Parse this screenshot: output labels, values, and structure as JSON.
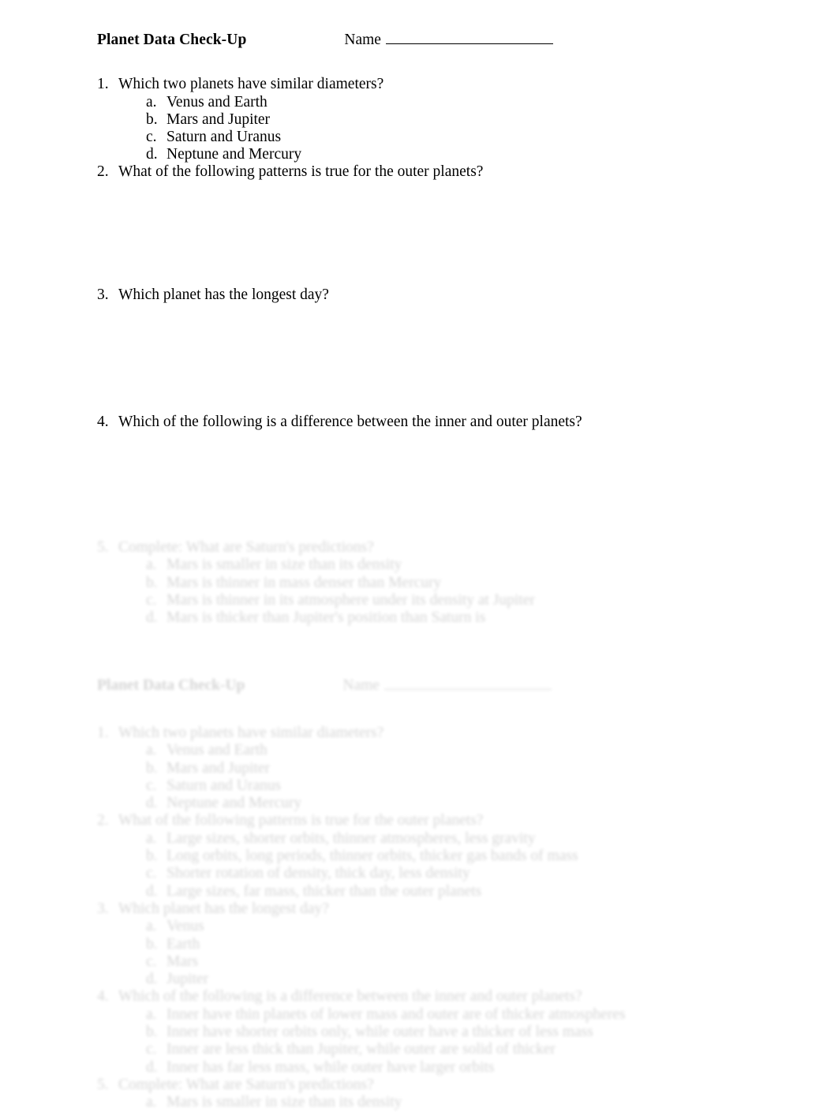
{
  "document": {
    "title": "Planet Data Check-Up",
    "name_label": "Name",
    "name_value": ""
  },
  "questions": [
    {
      "number": "1.",
      "text": "Which two planets have similar diameters?",
      "options": [
        {
          "letter": "a.",
          "text": "Venus and Earth"
        },
        {
          "letter": "b.",
          "text": "Mars and Jupiter"
        },
        {
          "letter": "c.",
          "text": "Saturn and Uranus"
        },
        {
          "letter": "d.",
          "text": "Neptune and Mercury"
        }
      ]
    },
    {
      "number": "2.",
      "text": "What of the following patterns is true for the outer planets?",
      "options": []
    },
    {
      "number": "3.",
      "text": "Which planet has the longest day?",
      "options": []
    },
    {
      "number": "4.",
      "text": "Which of the following is a difference between the inner and outer planets?",
      "options": []
    }
  ],
  "ghost": {
    "note": "faded blurred duplicate of the worksheet bleeding through",
    "title": "Planet Data Check-Up",
    "name_label": "Name",
    "block_a": {
      "number": "5.",
      "text": "Complete: What are Saturn's predictions?",
      "options": [
        {
          "letter": "a.",
          "text": "Mars is smaller in size than its density"
        },
        {
          "letter": "b.",
          "text": "Mars is thinner in mass denser than Mercury"
        },
        {
          "letter": "c.",
          "text": "Mars is thinner in its atmosphere under its density at Jupiter"
        },
        {
          "letter": "d.",
          "text": "Mars is thicker than Jupiter's position than Saturn is"
        }
      ]
    },
    "block_b_questions": [
      {
        "number": "1.",
        "text": "Which two planets have similar diameters?",
        "options": [
          {
            "letter": "a.",
            "text": "Venus and Earth"
          },
          {
            "letter": "b.",
            "text": "Mars and Jupiter"
          },
          {
            "letter": "c.",
            "text": "Saturn and Uranus"
          },
          {
            "letter": "d.",
            "text": "Neptune and Mercury"
          }
        ]
      },
      {
        "number": "2.",
        "text": "What of the following patterns is true for the outer planets?",
        "options": [
          {
            "letter": "a.",
            "text": "Large sizes, shorter orbits, thinner atmospheres, less gravity"
          },
          {
            "letter": "b.",
            "text": "Long orbits, long periods, thinner orbits, thicker gas bands of mass"
          },
          {
            "letter": "c.",
            "text": "Shorter rotation of density, thick day, less density"
          },
          {
            "letter": "d.",
            "text": "Large sizes, far mass, thicker than the outer planets"
          }
        ]
      },
      {
        "number": "3.",
        "text": "Which planet has the longest day?",
        "options": [
          {
            "letter": "a.",
            "text": "Venus"
          },
          {
            "letter": "b.",
            "text": "Earth"
          },
          {
            "letter": "c.",
            "text": "Mars"
          },
          {
            "letter": "d.",
            "text": "Jupiter"
          }
        ]
      },
      {
        "number": "4.",
        "text": "Which of the following is a difference between the inner and outer planets?",
        "options": [
          {
            "letter": "a.",
            "text": "Inner have thin planets of lower mass and outer are of thicker atmospheres"
          },
          {
            "letter": "b.",
            "text": "Inner have shorter orbits only, while outer have a thicker of less mass"
          },
          {
            "letter": "c.",
            "text": "Inner are less thick than Jupiter, while outer are solid of thicker"
          },
          {
            "letter": "d.",
            "text": "Inner has far less mass, while outer have larger orbits"
          }
        ]
      },
      {
        "number": "5.",
        "text": "Complete: What are Saturn's predictions?",
        "options": [
          {
            "letter": "a.",
            "text": "Mars is smaller in size than its density"
          }
        ]
      }
    ]
  }
}
